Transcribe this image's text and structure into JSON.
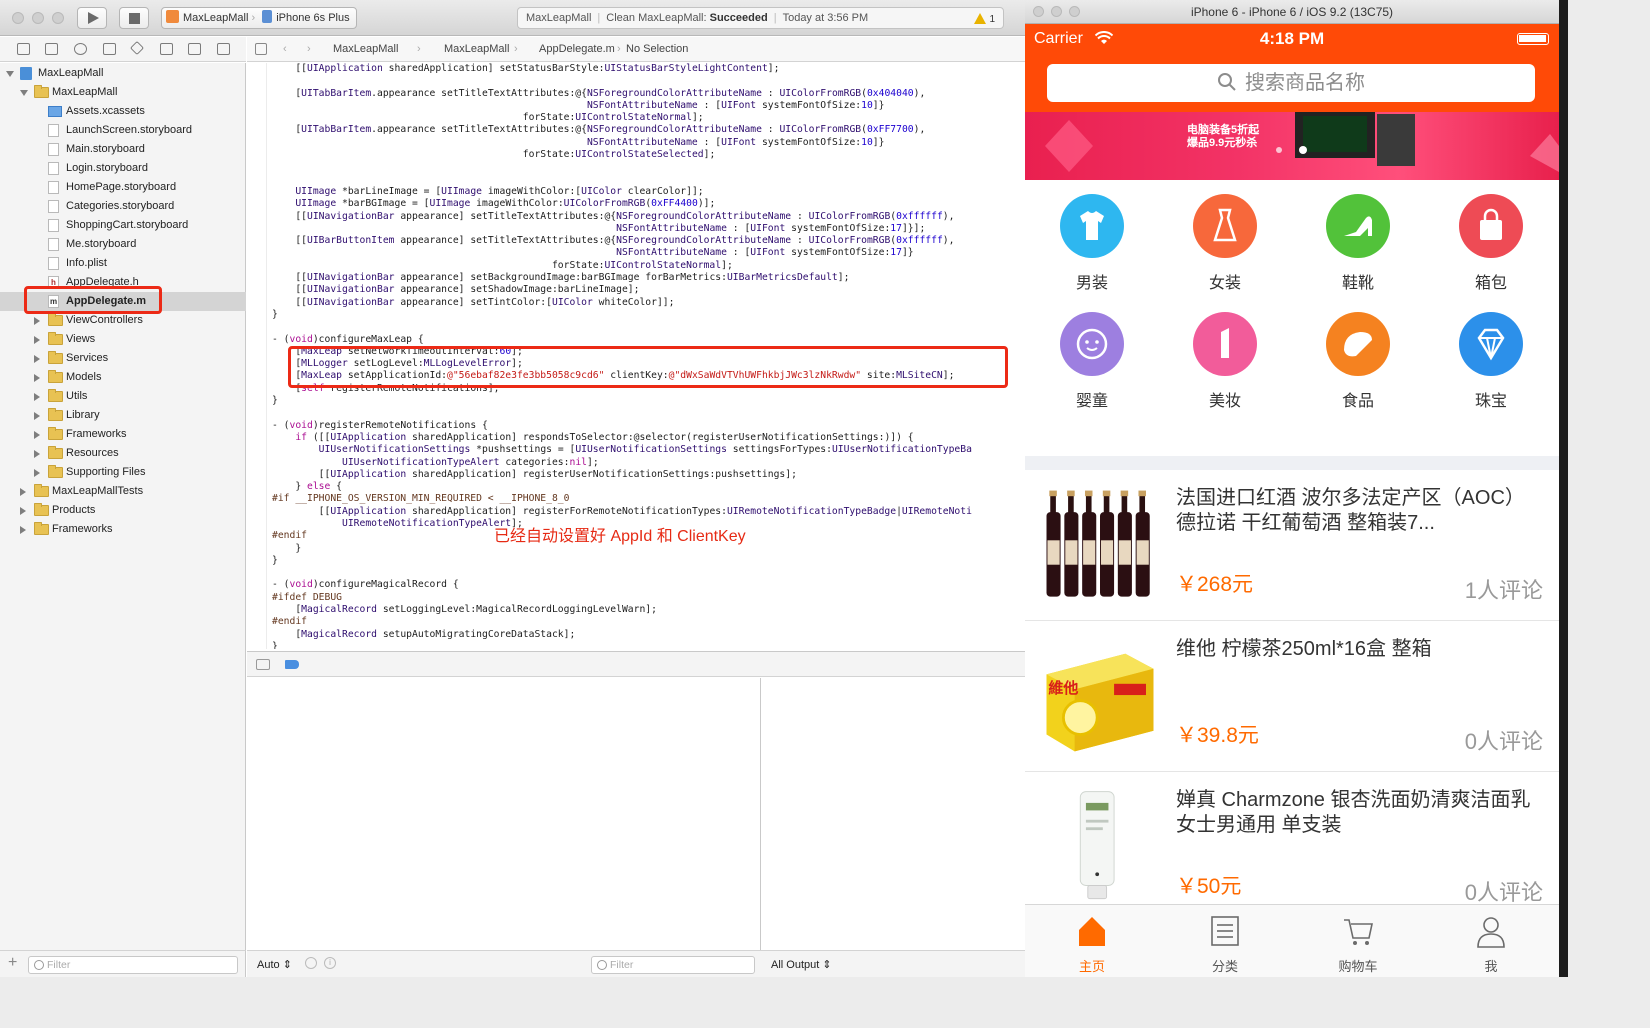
{
  "xcode": {
    "toolbar": {
      "scheme_project": "MaxLeapMall",
      "scheme_device": "iPhone 6s Plus",
      "activity_project": "MaxLeapMall",
      "activity_status_prefix": "Clean MaxLeapMall:",
      "activity_status_result": "Succeeded",
      "activity_time": "Today at 3:56 PM",
      "warning_count": "1"
    },
    "jumpbar": [
      "MaxLeapMall",
      "MaxLeapMall",
      "AppDelegate.m",
      "No Selection"
    ],
    "navigator": {
      "filter_placeholder": "Filter",
      "items": [
        {
          "label": "MaxLeapMall",
          "indent": 0,
          "kind": "project",
          "open": true
        },
        {
          "label": "MaxLeapMall",
          "indent": 1,
          "kind": "folder",
          "open": true
        },
        {
          "label": "Assets.xcassets",
          "indent": 2,
          "kind": "assets"
        },
        {
          "label": "LaunchScreen.storyboard",
          "indent": 2,
          "kind": "file"
        },
        {
          "label": "Main.storyboard",
          "indent": 2,
          "kind": "file"
        },
        {
          "label": "Login.storyboard",
          "indent": 2,
          "kind": "file"
        },
        {
          "label": "HomePage.storyboard",
          "indent": 2,
          "kind": "file"
        },
        {
          "label": "Categories.storyboard",
          "indent": 2,
          "kind": "file"
        },
        {
          "label": "ShoppingCart.storyboard",
          "indent": 2,
          "kind": "file"
        },
        {
          "label": "Me.storyboard",
          "indent": 2,
          "kind": "file"
        },
        {
          "label": "Info.plist",
          "indent": 2,
          "kind": "file"
        },
        {
          "label": "AppDelegate.h",
          "indent": 2,
          "kind": "h"
        },
        {
          "label": "AppDelegate.m",
          "indent": 2,
          "kind": "m",
          "selected": true
        },
        {
          "label": "ViewControllers",
          "indent": 2,
          "kind": "folder"
        },
        {
          "label": "Views",
          "indent": 2,
          "kind": "folder"
        },
        {
          "label": "Services",
          "indent": 2,
          "kind": "folder"
        },
        {
          "label": "Models",
          "indent": 2,
          "kind": "folder"
        },
        {
          "label": "Utils",
          "indent": 2,
          "kind": "folder"
        },
        {
          "label": "Library",
          "indent": 2,
          "kind": "folder"
        },
        {
          "label": "Frameworks",
          "indent": 2,
          "kind": "folder"
        },
        {
          "label": "Resources",
          "indent": 2,
          "kind": "folder"
        },
        {
          "label": "Supporting Files",
          "indent": 2,
          "kind": "folder"
        },
        {
          "label": "MaxLeapMallTests",
          "indent": 1,
          "kind": "folder"
        },
        {
          "label": "Products",
          "indent": 1,
          "kind": "folder"
        },
        {
          "label": "Frameworks",
          "indent": 1,
          "kind": "folder"
        }
      ]
    },
    "code_lines": [
      "    [[UIApplication sharedApplication] setStatusBarStyle:UIStatusBarStyleLightContent];",
      "",
      "    [UITabBarItem.appearance setTitleTextAttributes:@{NSForegroundColorAttributeName : UIColorFromRGB(0x404040),",
      "                                                      NSFontAttributeName : [UIFont systemFontOfSize:10]}",
      "                                           forState:UIControlStateNormal];",
      "    [UITabBarItem.appearance setTitleTextAttributes:@{NSForegroundColorAttributeName : UIColorFromRGB(0xFF7700),",
      "                                                      NSFontAttributeName : [UIFont systemFontOfSize:10]}",
      "                                           forState:UIControlStateSelected];",
      "",
      "",
      "    UIImage *barLineImage = [UIImage imageWithColor:[UIColor clearColor]];",
      "    UIImage *barBGImage = [UIImage imageWithColor:UIColorFromRGB(0xFF4400)];",
      "    [[UINavigationBar appearance] setTitleTextAttributes:@{NSForegroundColorAttributeName : UIColorFromRGB(0xffffff),",
      "                                                           NSFontAttributeName : [UIFont systemFontOfSize:17]}];",
      "    [[UIBarButtonItem appearance] setTitleTextAttributes:@{NSForegroundColorAttributeName : UIColorFromRGB(0xffffff),",
      "                                                           NSFontAttributeName : [UIFont systemFontOfSize:17]}",
      "                                                forState:UIControlStateNormal];",
      "    [[UINavigationBar appearance] setBackgroundImage:barBGImage forBarMetrics:UIBarMetricsDefault];",
      "    [[UINavigationBar appearance] setShadowImage:barLineImage];",
      "    [[UINavigationBar appearance] setTintColor:[UIColor whiteColor]];",
      "}",
      "",
      "- (void)configureMaxLeap {",
      "    [MaxLeap setNetworkTimeoutInterval:60];",
      "    [MLLogger setLogLevel:MLLogLevelError];",
      "    [MaxLeap setApplicationId:@\"56ebaf82e3fe3bb5058c9cd6\" clientKey:@\"dWxSaWdVTVhUWFhkbjJWc3lzNkRwdw\" site:MLSiteCN];",
      "    [self registerRemoteNotifications];",
      "}",
      "",
      "- (void)registerRemoteNotifications {",
      "    if ([[UIApplication sharedApplication] respondsToSelector:@selector(registerUserNotificationSettings:)]) {",
      "        UIUserNotificationSettings *pushsettings = [UIUserNotificationSettings settingsForTypes:UIUserNotificationTypeBa",
      "            UIUserNotificationTypeAlert categories:nil];",
      "        [[UIApplication sharedApplication] registerUserNotificationSettings:pushsettings];",
      "    } else {",
      "#if __IPHONE_OS_VERSION_MIN_REQUIRED < __IPHONE_8_0",
      "        [[UIApplication sharedApplication] registerForRemoteNotificationTypes:UIRemoteNotificationTypeBadge|UIRemoteNoti",
      "            UIRemoteNotificationTypeAlert];",
      "#endif",
      "    }",
      "}",
      "",
      "- (void)configureMagicalRecord {",
      "#ifdef DEBUG",
      "    [MagicalRecord setLoggingLevel:MagicalRecordLoggingLevelWarn];",
      "#endif",
      "    [MagicalRecord setupAutoMigratingCoreDataStack];",
      "}"
    ],
    "annotation": "已经自动设置好 AppId 和 ClientKey",
    "debug": {
      "variables_scope": "Auto",
      "filter_placeholder": "Filter",
      "output_scope": "All Output"
    }
  },
  "simulator": {
    "title": "iPhone 6 - iPhone 6 / iOS 9.2 (13C75)",
    "status": {
      "carrier": "Carrier",
      "time": "4:18 PM"
    },
    "search_placeholder": "搜索商品名称",
    "banner_text_1": "电脑装备5折起",
    "banner_text_2": "爆品9.9元秒杀",
    "categories": [
      {
        "label": "男装",
        "color": "#2eb7f0",
        "icon": "tshirt-icon"
      },
      {
        "label": "女装",
        "color": "#f7683b",
        "icon": "dress-icon"
      },
      {
        "label": "鞋靴",
        "color": "#52c23a",
        "icon": "heel-icon"
      },
      {
        "label": "箱包",
        "color": "#ee4b55",
        "icon": "bag-icon"
      },
      {
        "label": "婴童",
        "color": "#9d7fe0",
        "icon": "baby-icon"
      },
      {
        "label": "美妆",
        "color": "#f25c9a",
        "icon": "lipstick-icon"
      },
      {
        "label": "食品",
        "color": "#f58220",
        "icon": "bread-icon"
      },
      {
        "label": "珠宝",
        "color": "#2c90ea",
        "icon": "diamond-icon"
      }
    ],
    "products": [
      {
        "title": "法国进口红酒 波尔多法定产区（AOC） 德拉诺 干红葡萄酒 整箱装7...",
        "price": "￥268元",
        "reviews": "1人评论",
        "image": "wine-bottles"
      },
      {
        "title": "维他 柠檬茶250ml*16盒 整箱",
        "price": "￥39.8元",
        "reviews": "0人评论",
        "image": "lemon-tea-box"
      },
      {
        "title": "婵真 Charmzone 银杏洗面奶清爽洁面乳 女士男通用 单支装",
        "price": "￥50元",
        "reviews": "0人评论",
        "image": "cleanser-tube"
      }
    ],
    "tabs": [
      {
        "label": "主页",
        "icon": "home-icon",
        "active": true
      },
      {
        "label": "分类",
        "icon": "list-icon",
        "active": false
      },
      {
        "label": "购物车",
        "icon": "cart-icon",
        "active": false
      },
      {
        "label": "我",
        "icon": "user-icon",
        "active": false
      }
    ],
    "colors": {
      "brand": "#ff4a07",
      "price": "#ff6a00",
      "highlight": "#ec2a16"
    }
  }
}
